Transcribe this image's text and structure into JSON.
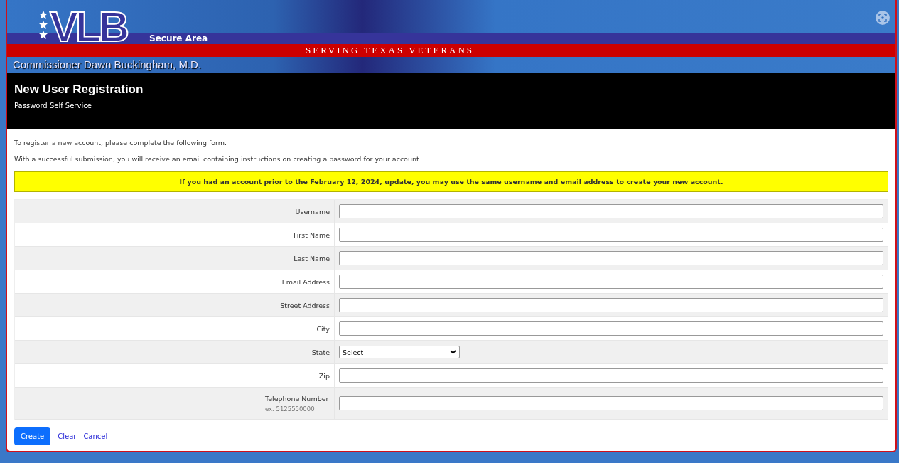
{
  "banner": {
    "logo": "VLB",
    "area": "Secure Area",
    "tagline": "SERVING TEXAS VETERANS",
    "commissioner": "Commissioner Dawn Buckingham, M.D."
  },
  "header": {
    "title": "New User Registration",
    "subtitle": "Password Self Service"
  },
  "intro": [
    "To register a new account, please complete the following form.",
    "With a successful submission, you will receive an email containing instructions on creating a password for your account."
  ],
  "notice": "If you had an account prior to the February 12, 2024, update, you may use the same username and email address to create your new account.",
  "fields": [
    {
      "kind": "text",
      "label": "Username"
    },
    {
      "kind": "text",
      "label": "First Name"
    },
    {
      "kind": "text",
      "label": "Last Name"
    },
    {
      "kind": "text",
      "label": "Email Address"
    },
    {
      "kind": "text",
      "label": "Street Address"
    },
    {
      "kind": "text",
      "label": "City"
    },
    {
      "kind": "select",
      "label": "State",
      "value": "Select"
    },
    {
      "kind": "text",
      "label": "Zip"
    },
    {
      "kind": "text",
      "label": "Telephone Number",
      "hint": "ex. 5125550000"
    }
  ],
  "actions": [
    {
      "kind": "button",
      "label": "Create"
    },
    {
      "kind": "link",
      "label": "Clear"
    },
    {
      "kind": "link",
      "label": "Cancel"
    }
  ]
}
